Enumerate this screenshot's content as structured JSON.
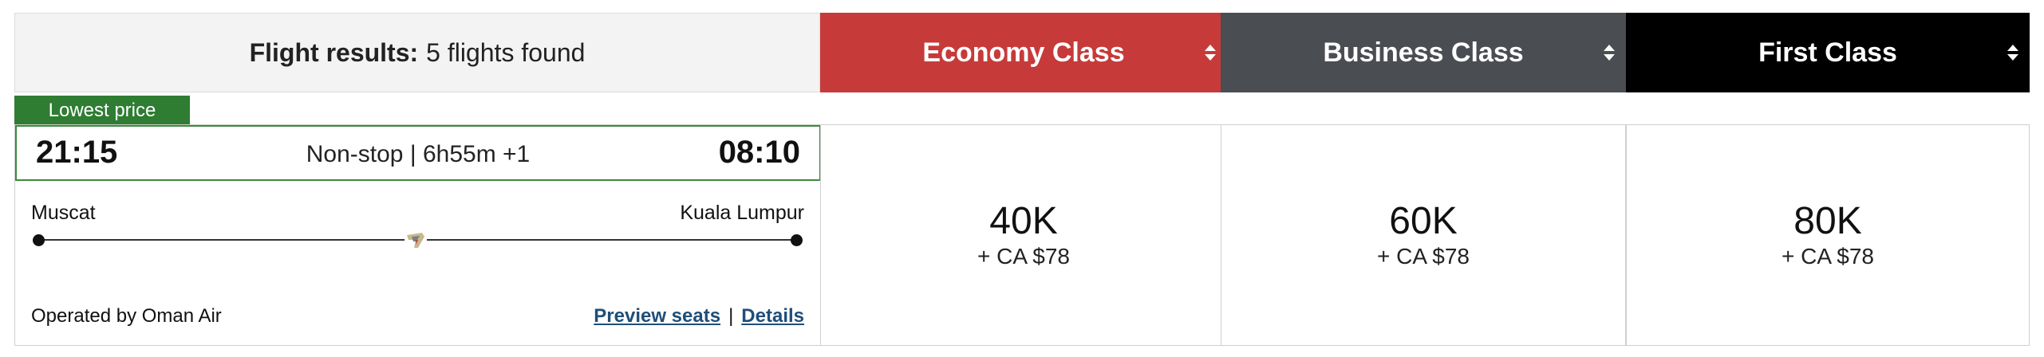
{
  "header": {
    "results_label": "Flight results:",
    "results_count": "5 flights found",
    "classes": [
      {
        "label": "Economy Class",
        "color": "#c73a3a"
      },
      {
        "label": "Business Class",
        "color": "#4a4d52"
      },
      {
        "label": "First Class",
        "color": "#000000"
      }
    ]
  },
  "flight": {
    "badge": "Lowest price",
    "departure_time": "21:15",
    "arrival_time": "08:10",
    "duration": "Non-stop | 6h55m +1",
    "origin": "Muscat",
    "destination": "Kuala Lumpur",
    "operated_by": "Operated by Oman Air",
    "preview_seats": "Preview seats",
    "separator": "|",
    "details": "Details",
    "airline_icon": "oman-air-tail-icon",
    "fares": [
      {
        "miles": "40K",
        "tax": "+ CA $78"
      },
      {
        "miles": "60K",
        "tax": "+ CA $78"
      },
      {
        "miles": "80K",
        "tax": "+ CA $78"
      }
    ]
  },
  "colors": {
    "accent_green": "#2e7d32",
    "link_blue": "#1f4e79"
  }
}
